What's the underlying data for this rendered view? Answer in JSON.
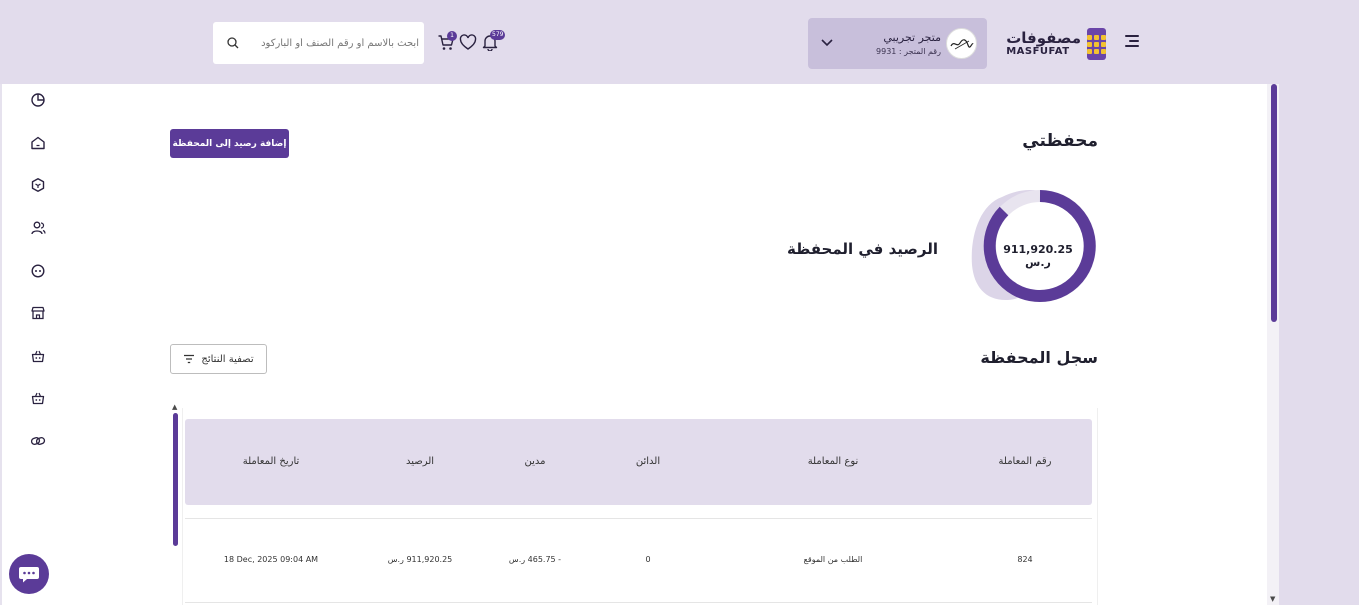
{
  "header": {
    "logo_ar": "مصفوفات",
    "logo_en": "MASFUFAT",
    "store_name": "متجر تجريبي",
    "store_number": "رقم المتجر : 9931",
    "notifications_count": "579",
    "cart_count": "1",
    "search_placeholder": "ابحث بالاسم أو رقم الصنف أو الباركود"
  },
  "wallet": {
    "title": "محفظتي",
    "add_button": "إضافة رصيد إلى المحفظة",
    "balance_value": "911,920.25 ر.س",
    "balance_label": "الرصيد في المحفظة"
  },
  "log": {
    "title": "سجل المحفظة",
    "filter_label": "تصفية النتائج",
    "columns": [
      "رقم المعاملة",
      "نوع المعاملة",
      "الدائن",
      "مدين",
      "الرصيد",
      "تاريخ المعاملة"
    ],
    "rows": [
      [
        "824",
        "الطلب من الموقع",
        "0",
        "- 465.75 ر.س",
        "911,920.25 ر.س",
        "18 Dec, 2025 09:04 AM"
      ]
    ]
  },
  "sidebar": {
    "icons": [
      "pie-chart-icon",
      "home-icon",
      "box-icon",
      "users-icon",
      "face-icon",
      "store-icon",
      "basket-icon",
      "basket-alt-icon",
      "link-icon"
    ]
  },
  "colors": {
    "accent": "#5b3b98",
    "header_bg": "#e2dcec",
    "logo_dots": "#f2c230"
  }
}
